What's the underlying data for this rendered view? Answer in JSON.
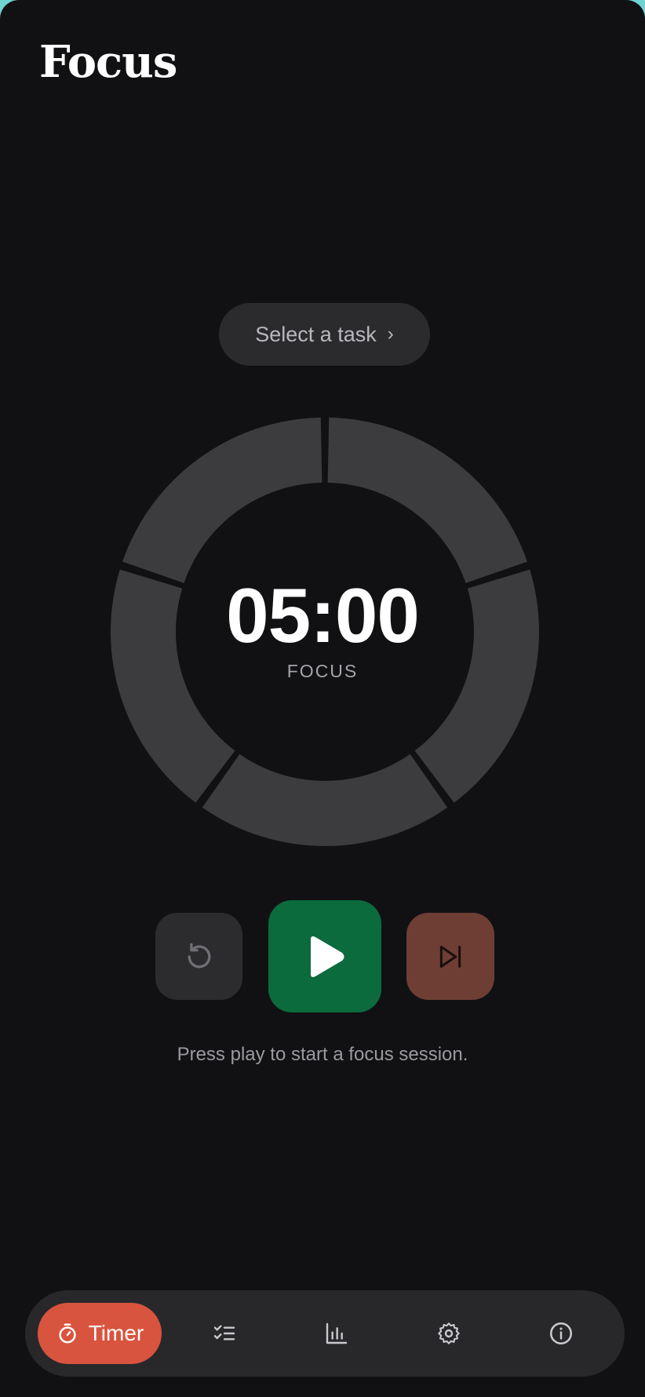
{
  "app": {
    "title": "Focus"
  },
  "task_selector": {
    "label": "Select a task",
    "chevron": "›"
  },
  "timer": {
    "time": "05:00",
    "mode": "FOCUS",
    "segments_total": 5,
    "segments_completed": 0,
    "progress": 0
  },
  "controls": {
    "reset": {
      "icon": "reset-icon"
    },
    "play": {
      "icon": "play-icon"
    },
    "skip": {
      "icon": "skip-next-icon"
    }
  },
  "hint": "Press play to start a focus session.",
  "nav": {
    "items": [
      {
        "id": "timer",
        "label": "Timer",
        "icon": "stopwatch-icon",
        "active": true
      },
      {
        "id": "tasks",
        "label": "",
        "icon": "checklist-icon",
        "active": false
      },
      {
        "id": "stats",
        "label": "",
        "icon": "bar-chart-icon",
        "active": false
      },
      {
        "id": "settings",
        "label": "",
        "icon": "gear-icon",
        "active": false
      },
      {
        "id": "info",
        "label": "",
        "icon": "info-icon",
        "active": false
      }
    ]
  },
  "colors": {
    "background": "#111113",
    "ring_segment": "#3c3c3f",
    "play": "#0b6b3c",
    "skip": "#6e3e35",
    "reset": "#2c2c2f",
    "nav_active": "#d9543e",
    "accent_corner": "#6fd3d0"
  }
}
